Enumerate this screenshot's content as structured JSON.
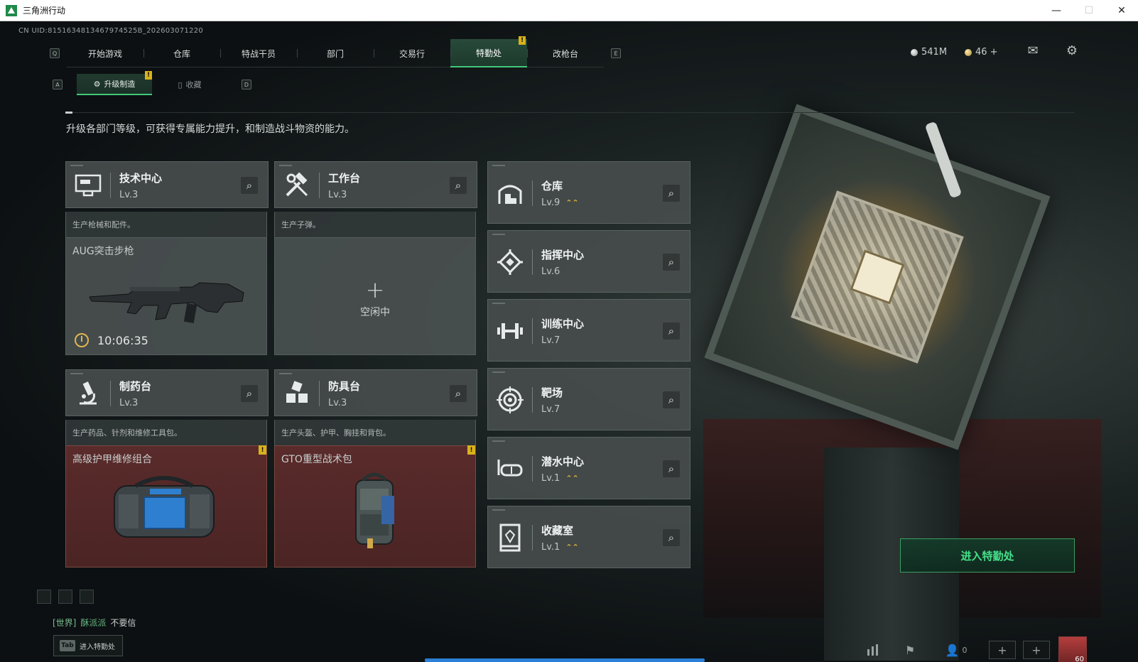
{
  "window": {
    "title": "三角洲行动",
    "minimize": "—",
    "maximize": "☐",
    "close": "✕"
  },
  "uid": "CN UID:8151634813467974525B_202603071220",
  "nav": {
    "key_left": "Q",
    "key_right": "E",
    "tabs": [
      {
        "label": "开始游戏"
      },
      {
        "label": "仓库"
      },
      {
        "label": "特战干员"
      },
      {
        "label": "部门"
      },
      {
        "label": "交易行"
      },
      {
        "label": "特勤处",
        "active": true,
        "alert": "!"
      },
      {
        "label": "改枪台"
      }
    ]
  },
  "currency": {
    "silver": "541M",
    "gold": "46 +"
  },
  "subnav": {
    "key_left": "A",
    "key_right": "D",
    "tabs": [
      {
        "label": "升级制造",
        "active": true,
        "alert": "!"
      },
      {
        "label": "收藏"
      }
    ]
  },
  "description": "升级各部门等级，可获得专属能力提升，和制造战斗物资的能力。",
  "production": [
    {
      "name": "技术中心",
      "level": "Lv.3",
      "desc": "生产枪械和配件。",
      "slot_title": "AUG突击步枪",
      "timer": "10:06:35",
      "icon": "monitor-icon"
    },
    {
      "name": "工作台",
      "level": "Lv.3",
      "desc": "生产子弹。",
      "idle_plus": "+",
      "idle": "空闲中",
      "icon": "hammer-wrench-icon"
    },
    {
      "name": "制药台",
      "level": "Lv.3",
      "desc": "生产药品、针剂和维修工具包。",
      "slot_title": "高级护甲维修组合",
      "alert": "!",
      "icon": "microscope-icon"
    },
    {
      "name": "防具台",
      "level": "Lv.3",
      "desc": "生产头盔、护甲、胸挂和背包。",
      "slot_title": "GTO重型战术包",
      "alert": "!",
      "icon": "cubes-icon"
    }
  ],
  "departments": [
    {
      "name": "仓库",
      "level": "Lv.9",
      "upgrade": "⌃⌃",
      "icon": "warehouse-icon"
    },
    {
      "name": "指挥中心",
      "level": "Lv.6",
      "icon": "command-icon"
    },
    {
      "name": "训练中心",
      "level": "Lv.7",
      "icon": "dumbbell-icon"
    },
    {
      "name": "靶场",
      "level": "Lv.7",
      "icon": "target-icon"
    },
    {
      "name": "潜水中心",
      "level": "Lv.1",
      "upgrade": "⌃⌃",
      "icon": "diving-mask-icon"
    },
    {
      "name": "收藏室",
      "level": "Lv.1",
      "upgrade": "⌃⌃",
      "icon": "collection-icon"
    }
  ],
  "enter_button": "进入特勤处",
  "chat": {
    "channel": "[世界]",
    "user": "酥派派",
    "message": "不要信"
  },
  "tab_hint": {
    "key": "Tab",
    "label": "进入特勤处"
  },
  "social": {
    "friends_count": "0",
    "avatar_level": "60"
  },
  "colors": {
    "accent_green": "#41c97a",
    "alert_yellow": "#d9b21b",
    "upgrade_gold": "#e4b33b",
    "ready_slot_red": "#5a2b2b"
  }
}
